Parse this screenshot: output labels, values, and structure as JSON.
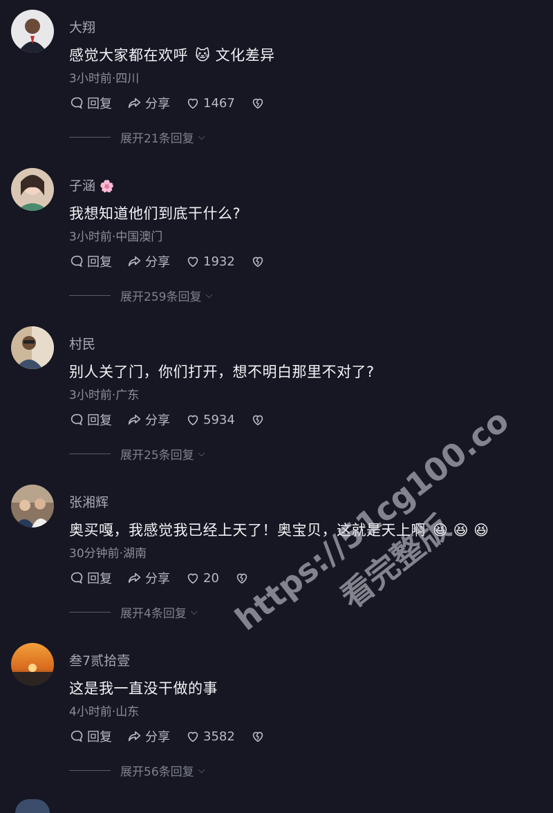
{
  "comments": [
    {
      "user": "大翔",
      "text": "感觉大家都在欢呼",
      "emoji": "🐱",
      "text2": "文化差异",
      "meta": "3小时前·四川",
      "reply": "回复",
      "share": "分享",
      "likes": "1467",
      "expand": "展开21条回复"
    },
    {
      "user": "子涵",
      "flower": "🌸",
      "text": "我想知道他们到底干什么?",
      "meta": "3小时前·中国澳门",
      "reply": "回复",
      "share": "分享",
      "likes": "1932",
      "expand": "展开259条回复"
    },
    {
      "user": "村民",
      "text": "别人关了门，你们打开，想不明白那里不对了?",
      "meta": "3小时前·广东",
      "reply": "回复",
      "share": "分享",
      "likes": "5934",
      "expand": "展开25条回复"
    },
    {
      "user": "张湘辉",
      "text": "奥买嘎，我感觉我已经上天了！奥宝贝，这就是天上啊",
      "emojis": "😆 😆 😆",
      "meta": "30分钟前·湖南",
      "reply": "回复",
      "share": "分享",
      "likes": "20",
      "expand": "展开4条回复"
    },
    {
      "user": "叁7贰拾壹",
      "text": "这是我一直没干做的事",
      "meta": "4小时前·山东",
      "reply": "回复",
      "share": "分享",
      "likes": "3582",
      "expand": "展开56条回复"
    }
  ],
  "watermark": {
    "line1": "https://51cg100.co",
    "line2": "看完整版"
  },
  "colors": {
    "background": "#161722",
    "text": "#f2f2f6",
    "muted": "#8c8e99"
  }
}
